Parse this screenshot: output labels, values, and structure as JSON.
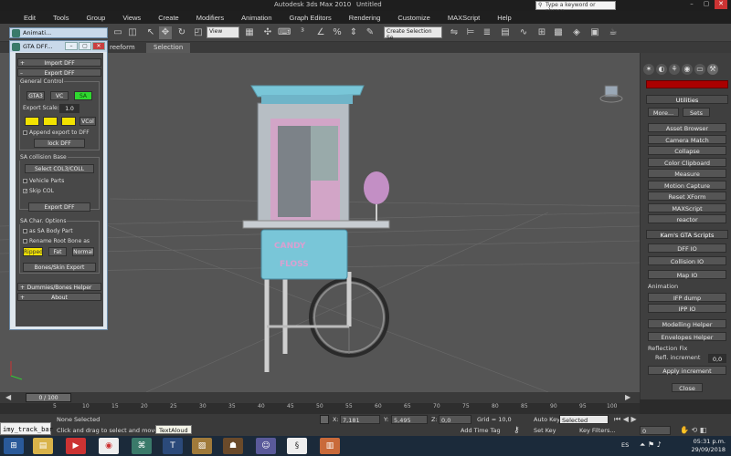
{
  "titlebar": {
    "app_title": "Autodesk 3ds Max  2010",
    "doc_title": "Untitled",
    "search_placeholder": "Type a keyword or phrase"
  },
  "menu": [
    "Edit",
    "Tools",
    "Group",
    "Views",
    "Create",
    "Modifiers",
    "Animation",
    "Graph Editors",
    "Rendering",
    "Customize",
    "MAXScript",
    "Help"
  ],
  "toolbar": {
    "view_dropdown": "View",
    "selection_set": "Create Selection Se"
  },
  "ribbon": {
    "tabs": [
      "reeform",
      "Selection"
    ]
  },
  "gta_windows": {
    "anim_title": "Animati...",
    "dff_title": "GTA DFF..."
  },
  "gta_panel": {
    "import_dff": "Import DFF",
    "export_dff": "Export DFF",
    "general_control": "General Control",
    "game_buttons": [
      "GTA3",
      "VC",
      "SA"
    ],
    "export_scale_label": "Export Scale:",
    "export_scale_value": "1.0",
    "yellow_labels": [
      "",
      "",
      ""
    ],
    "vcol": "VCol",
    "append_export": "Append export to DFF",
    "lock_dff": "lock DFF",
    "sa_collision_base": "SA collision Base",
    "select_col": "Select COL3/COLL",
    "vehicle_parts": "Vehicle Parts",
    "skip_col": "Skip COL",
    "export_dff_btn": "Export DFF",
    "sa_char_options": "SA Char. Options",
    "as_sa_body_part": "as SA Body Part",
    "rename_root_bone": "Rename Root Bone as",
    "bone_types": [
      "Ripped",
      "Fat",
      "Normal"
    ],
    "bones_skin_export": "Bones/Skin Export",
    "dummies_helper": "Dummies/Bones Helper",
    "about": "About"
  },
  "command_panel": {
    "utilities_head": "Utilities",
    "more": "More...",
    "sets": "Sets",
    "utilities": [
      "Asset Browser",
      "Camera Match",
      "Collapse",
      "Color Clipboard",
      "Measure",
      "Motion Capture",
      "Reset XForm",
      "MAXScript",
      "reactor"
    ],
    "kams_head": "Kam's GTA Scripts",
    "kams_buttons": [
      "DFF IO",
      "Collision IO",
      "Map IO"
    ],
    "animation_label": "Animation",
    "anim_buttons": [
      "IFP dump",
      "IPP IO"
    ],
    "modelling_helper": "Modelling Helper",
    "envelopes_helper": "Envelopes Helper",
    "reflection_fix": "Reflection Fix",
    "refl_increment_label": "Refl. increment",
    "refl_increment_value": "0,0",
    "apply_increment": "Apply increment",
    "close": "Close"
  },
  "timeline": {
    "frame": "0 / 100",
    "ticks": [
      "5",
      "10",
      "15",
      "20",
      "25",
      "30",
      "35",
      "40",
      "45",
      "50",
      "55",
      "60",
      "65",
      "70",
      "75",
      "80",
      "85",
      "90",
      "95",
      "100"
    ]
  },
  "status": {
    "selection": "None Selected",
    "prompt": "Click and drag to select and move object",
    "x_label": "X:",
    "x_value": "7,181",
    "y_label": "Y:",
    "y_value": "5,495",
    "z_label": "Z:",
    "z_value": "0,0",
    "grid": "Grid = 10,0",
    "add_time_tag": "Add Time Tag",
    "auto_key": "Auto Key",
    "set_key": "Set Key",
    "auto_key_mode": "Selected",
    "key_filters": "Key Filters...",
    "frame_field": "0",
    "maxscript_text": "imy_track_bar",
    "tooltip": "TextAloud"
  },
  "taskbar": {
    "lang": "ES",
    "time": "05:31 p.m.",
    "date": "29/09/2018"
  },
  "colors": {
    "viewport_bg": "#555555",
    "active_game": "#2fd82f",
    "yellow_btn": "#f2e200",
    "cart_cyan": "#79c6d8",
    "cart_pink": "#d7a1c8"
  }
}
